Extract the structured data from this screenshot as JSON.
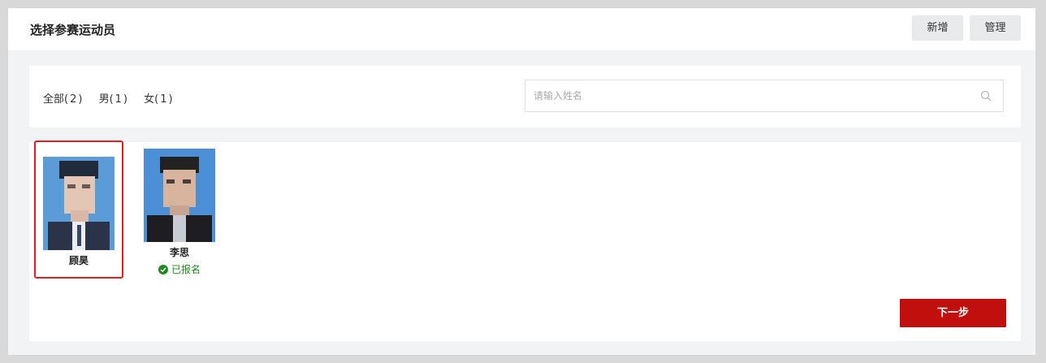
{
  "header": {
    "title": "选择参赛运动员",
    "add_label": "新增",
    "manage_label": "管理"
  },
  "filters": {
    "tabs": [
      {
        "label": "全部",
        "count": "(2)"
      },
      {
        "label": "男",
        "count": "(1)"
      },
      {
        "label": "女",
        "count": "(1)"
      }
    ]
  },
  "search": {
    "placeholder": "请输入姓名",
    "icon": "search-icon"
  },
  "athletes": [
    {
      "name": "顾昊",
      "selected": true,
      "status": ""
    },
    {
      "name": "李思",
      "selected": false,
      "status": "已报名"
    }
  ],
  "colors": {
    "accent_red": "#c00f0c",
    "selected_border": "#e02020",
    "registered_green": "#1f8a1f"
  },
  "footer": {
    "next_label": "下一步"
  }
}
